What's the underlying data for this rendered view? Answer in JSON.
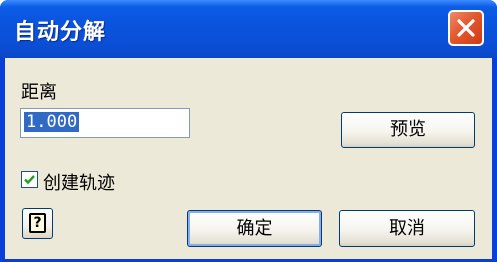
{
  "window": {
    "title": "自动分解"
  },
  "icons": {
    "close": "close-icon",
    "check": "checkmark-icon",
    "help": "help-icon"
  },
  "form": {
    "distance_label": "距离",
    "distance_value": "1.000",
    "preview_button": "预览",
    "create_trail_label": "创建轨迹",
    "create_trail_checked": true,
    "help_glyph": "?",
    "ok_button": "确定",
    "cancel_button": "取消"
  },
  "colors": {
    "titlebar": "#0a54df",
    "close_button": "#e2582f",
    "client_background": "#ece9d8",
    "selection": "#316ac5",
    "checkmark": "#21a121"
  }
}
